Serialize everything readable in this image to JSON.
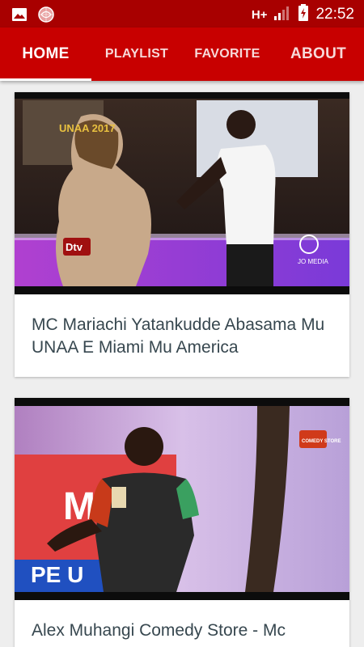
{
  "status_bar": {
    "network": "H+",
    "time": "22:52",
    "icons": [
      "image-icon",
      "app-notification-icon",
      "signal-icon",
      "battery-charging-icon"
    ]
  },
  "tabs": [
    {
      "label": "HOME",
      "active": true
    },
    {
      "label": "PLAYLIST",
      "active": false
    },
    {
      "label": "FAVORITE",
      "active": false
    },
    {
      "label": "ABOUT",
      "active": false
    }
  ],
  "videos": [
    {
      "title": "MC Mariachi Yatankudde Abasama Mu UNAA E Miami Mu America",
      "thumb_overlay": {
        "event": "UNAA 2017",
        "logo": "Dtv",
        "watermark": "JO MEDIA"
      }
    },
    {
      "title": "Alex Muhangi Comedy Store - Mc",
      "thumb_overlay": {
        "banner": "MED",
        "banner2": "PE U",
        "logo": "COMEDY STORE"
      }
    }
  ],
  "colors": {
    "status_bar": "#a80000",
    "app_bar": "#c80000",
    "background": "#eeeeee",
    "title_text": "#37474f"
  }
}
